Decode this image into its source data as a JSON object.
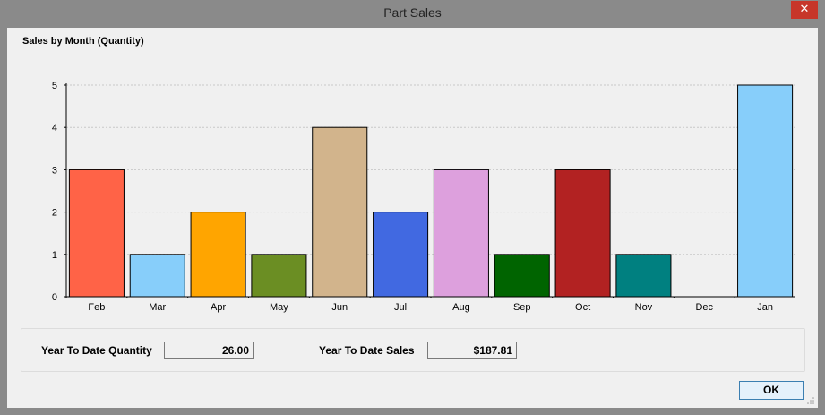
{
  "window": {
    "title": "Part Sales",
    "close_label": "✕"
  },
  "chart_data": {
    "type": "bar",
    "title": "Sales by Month (Quantity)",
    "categories": [
      "Feb",
      "Mar",
      "Apr",
      "May",
      "Jun",
      "Jul",
      "Aug",
      "Sep",
      "Oct",
      "Nov",
      "Dec",
      "Jan"
    ],
    "values": [
      3,
      1,
      2,
      1,
      4,
      2,
      3,
      1,
      3,
      1,
      0,
      5
    ],
    "colors": [
      "#ff6347",
      "#87cefa",
      "#ffa500",
      "#6b8e23",
      "#d2b48c",
      "#4169e1",
      "#dda0dd",
      "#006400",
      "#b22222",
      "#008080",
      "#a0a0a0",
      "#87cefa"
    ],
    "ylim": [
      0,
      5
    ],
    "yticks": [
      "0",
      "1",
      "2",
      "3",
      "4",
      "5"
    ],
    "grid": true,
    "xlabel": "",
    "ylabel": ""
  },
  "summary": {
    "qty_label": "Year To Date Quantity",
    "qty_value": "26.00",
    "sales_label": "Year To Date Sales",
    "sales_value": "$187.81"
  },
  "buttons": {
    "ok_label": "OK"
  }
}
